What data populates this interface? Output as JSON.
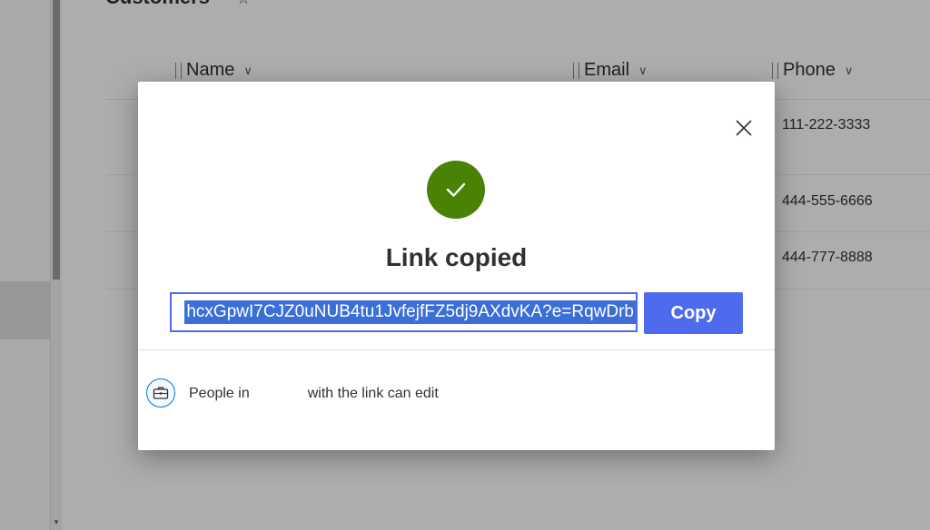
{
  "background": {
    "page_title": "Customers",
    "columns": [
      {
        "label": "Name"
      },
      {
        "label": "Email"
      },
      {
        "label": "Phone"
      }
    ],
    "rows": [
      {
        "phone": "111-222-3333"
      },
      {
        "phone": "444-555-6666"
      },
      {
        "phone": "444-777-8888"
      }
    ]
  },
  "dialog": {
    "title": "Link copied",
    "link_value": "hcxGpwI7CJZ0uNUB4tu1JvfejfFZ5dj9AXdvKA?e=RqwDrb",
    "copy_label": "Copy",
    "permission": {
      "prefix": "People in",
      "suffix": "with the link can edit"
    }
  },
  "icons": {
    "close": "close-icon",
    "success": "checkmark-icon",
    "permission": "briefcase-icon",
    "star": "star-icon",
    "column_menu": "chevron-down-icon"
  },
  "colors": {
    "success_green": "#498205",
    "accent_blue": "#4f6bed",
    "selection_blue": "#3b6fd6"
  }
}
